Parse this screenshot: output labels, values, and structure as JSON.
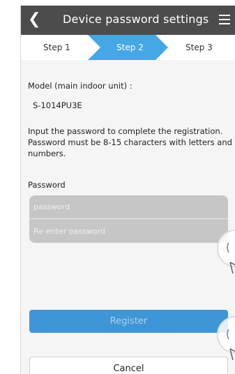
{
  "header": {
    "back_icon": "chevron-left",
    "title": "Device password settings",
    "menu_icon": "hamburger-menu"
  },
  "steps": {
    "items": [
      {
        "label": "Step 1",
        "active": false
      },
      {
        "label": "Step 2",
        "active": true
      },
      {
        "label": "Step 3",
        "active": false
      }
    ],
    "active_color": "#45a7e6"
  },
  "model": {
    "label": "Model (main indoor unit) :",
    "value": "S-1014PU3E"
  },
  "instructions": "Input the password to complete the registration. Password must be 8-15 characters with letters and numbers.",
  "password": {
    "label": "Password",
    "field_placeholder": "password",
    "confirm_placeholder": "Re-enter password"
  },
  "buttons": {
    "register": "Register",
    "cancel": "Cancel"
  },
  "colors": {
    "header_bg": "#4c4c4c",
    "accent": "#3f96d6"
  }
}
